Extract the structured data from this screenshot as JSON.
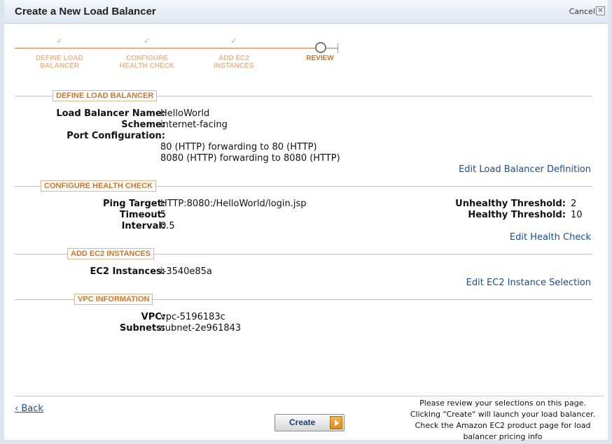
{
  "window": {
    "title": "Create a New Load Balancer",
    "cancel_label": "Cancel",
    "close_glyph": "✕"
  },
  "wizard": {
    "steps": [
      {
        "line1": "DEFINE LOAD",
        "line2": "BALANCER",
        "done": true
      },
      {
        "line1": "CONFIGURE",
        "line2": "HEALTH CHECK",
        "done": true
      },
      {
        "line1": "ADD EC2",
        "line2": "INSTANCES",
        "done": true
      },
      {
        "line1": "REVIEW",
        "line2": "",
        "done": false
      }
    ],
    "check_glyph": "✓"
  },
  "sections": {
    "define": {
      "heading": "DEFINE LOAD BALANCER",
      "name_label": "Load Balancer Name:",
      "name_value": "HelloWorld",
      "scheme_label": "Scheme:",
      "scheme_value": "internet-facing",
      "port_label": "Port Configuration:",
      "ports": [
        "80 (HTTP) forwarding to 80 (HTTP)",
        "8080 (HTTP) forwarding to 8080 (HTTP)"
      ],
      "edit_link": "Edit Load Balancer Definition"
    },
    "health": {
      "heading": "CONFIGURE HEALTH CHECK",
      "ping_label": "Ping Target:",
      "ping_value": "HTTP:8080:/HelloWorld/login.jsp",
      "timeout_label": "Timeout:",
      "timeout_value": "5",
      "interval_label": "Interval:",
      "interval_value": "0.5",
      "unhealthy_label": "Unhealthy Threshold:",
      "unhealthy_value": "2",
      "healthy_label": "Healthy Threshold:",
      "healthy_value": "10",
      "edit_link": "Edit Health Check"
    },
    "ec2": {
      "heading": "ADD EC2 INSTANCES",
      "instances_label": "EC2 Instances:",
      "instances_value": "i-3540e85a",
      "edit_link": "Edit EC2 Instance Selection"
    },
    "vpc": {
      "heading": "VPC INFORMATION",
      "vpc_label": "VPC:",
      "vpc_value": "vpc-5196183c",
      "subnets_label": "Subnets:",
      "subnets_value": "subnet-2e961843"
    }
  },
  "footer": {
    "back_label": "‹ Back",
    "create_label": "Create",
    "note_lines": [
      "Please review your selections on this page.",
      "Clicking \"Create\" will launch your load balancer.",
      "Check the Amazon EC2 product page for load",
      "balancer pricing info"
    ]
  },
  "colors": {
    "accent": "#c9762a",
    "link": "#1a4f8f",
    "step_done": "#e3b98e"
  }
}
